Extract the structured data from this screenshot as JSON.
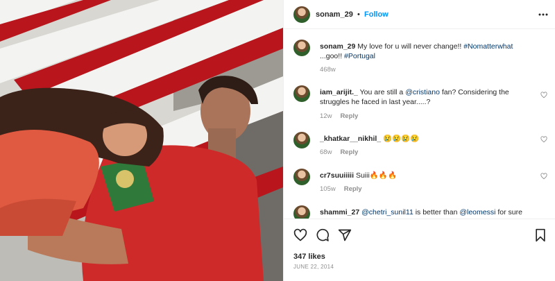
{
  "post": {
    "username": "sonam_29",
    "separator": "•",
    "follow_label": "Follow",
    "caption_user": "sonam_29",
    "caption_text": "My love for u will never change!!",
    "caption_tags": [
      "#Nomatterwhat",
      "...goo!!",
      "#Portugal"
    ],
    "caption_age": "468w",
    "likes": "347 likes",
    "date": "JUNE 22, 2014"
  },
  "comments": [
    {
      "user": "iam_arijit._",
      "parts": [
        "You are still a",
        "@cristiano",
        "fan? Considering the struggles he faced in last year.....?"
      ],
      "age": "12w",
      "reply": "Reply"
    },
    {
      "user": "_khatkar__nikhil_",
      "emoji": "😢😢😢😢",
      "age": "68w",
      "reply": "Reply"
    },
    {
      "user": "cr7suuiiiii",
      "text": "Suiii",
      "emoji": "🔥🔥🔥",
      "age": "105w",
      "reply": "Reply"
    },
    {
      "user": "shammi_27",
      "parts": [
        "@chetri_sunil11",
        "is better than",
        "@leomessi",
        "for sure"
      ]
    }
  ],
  "icons": {
    "more": "more-options-icon",
    "like": "heart-icon",
    "comment": "comment-icon",
    "share": "share-icon",
    "save": "bookmark-icon"
  },
  "colors": {
    "accent": "#0095f6",
    "tag": "#00376b",
    "muted": "#8e8e8e"
  }
}
